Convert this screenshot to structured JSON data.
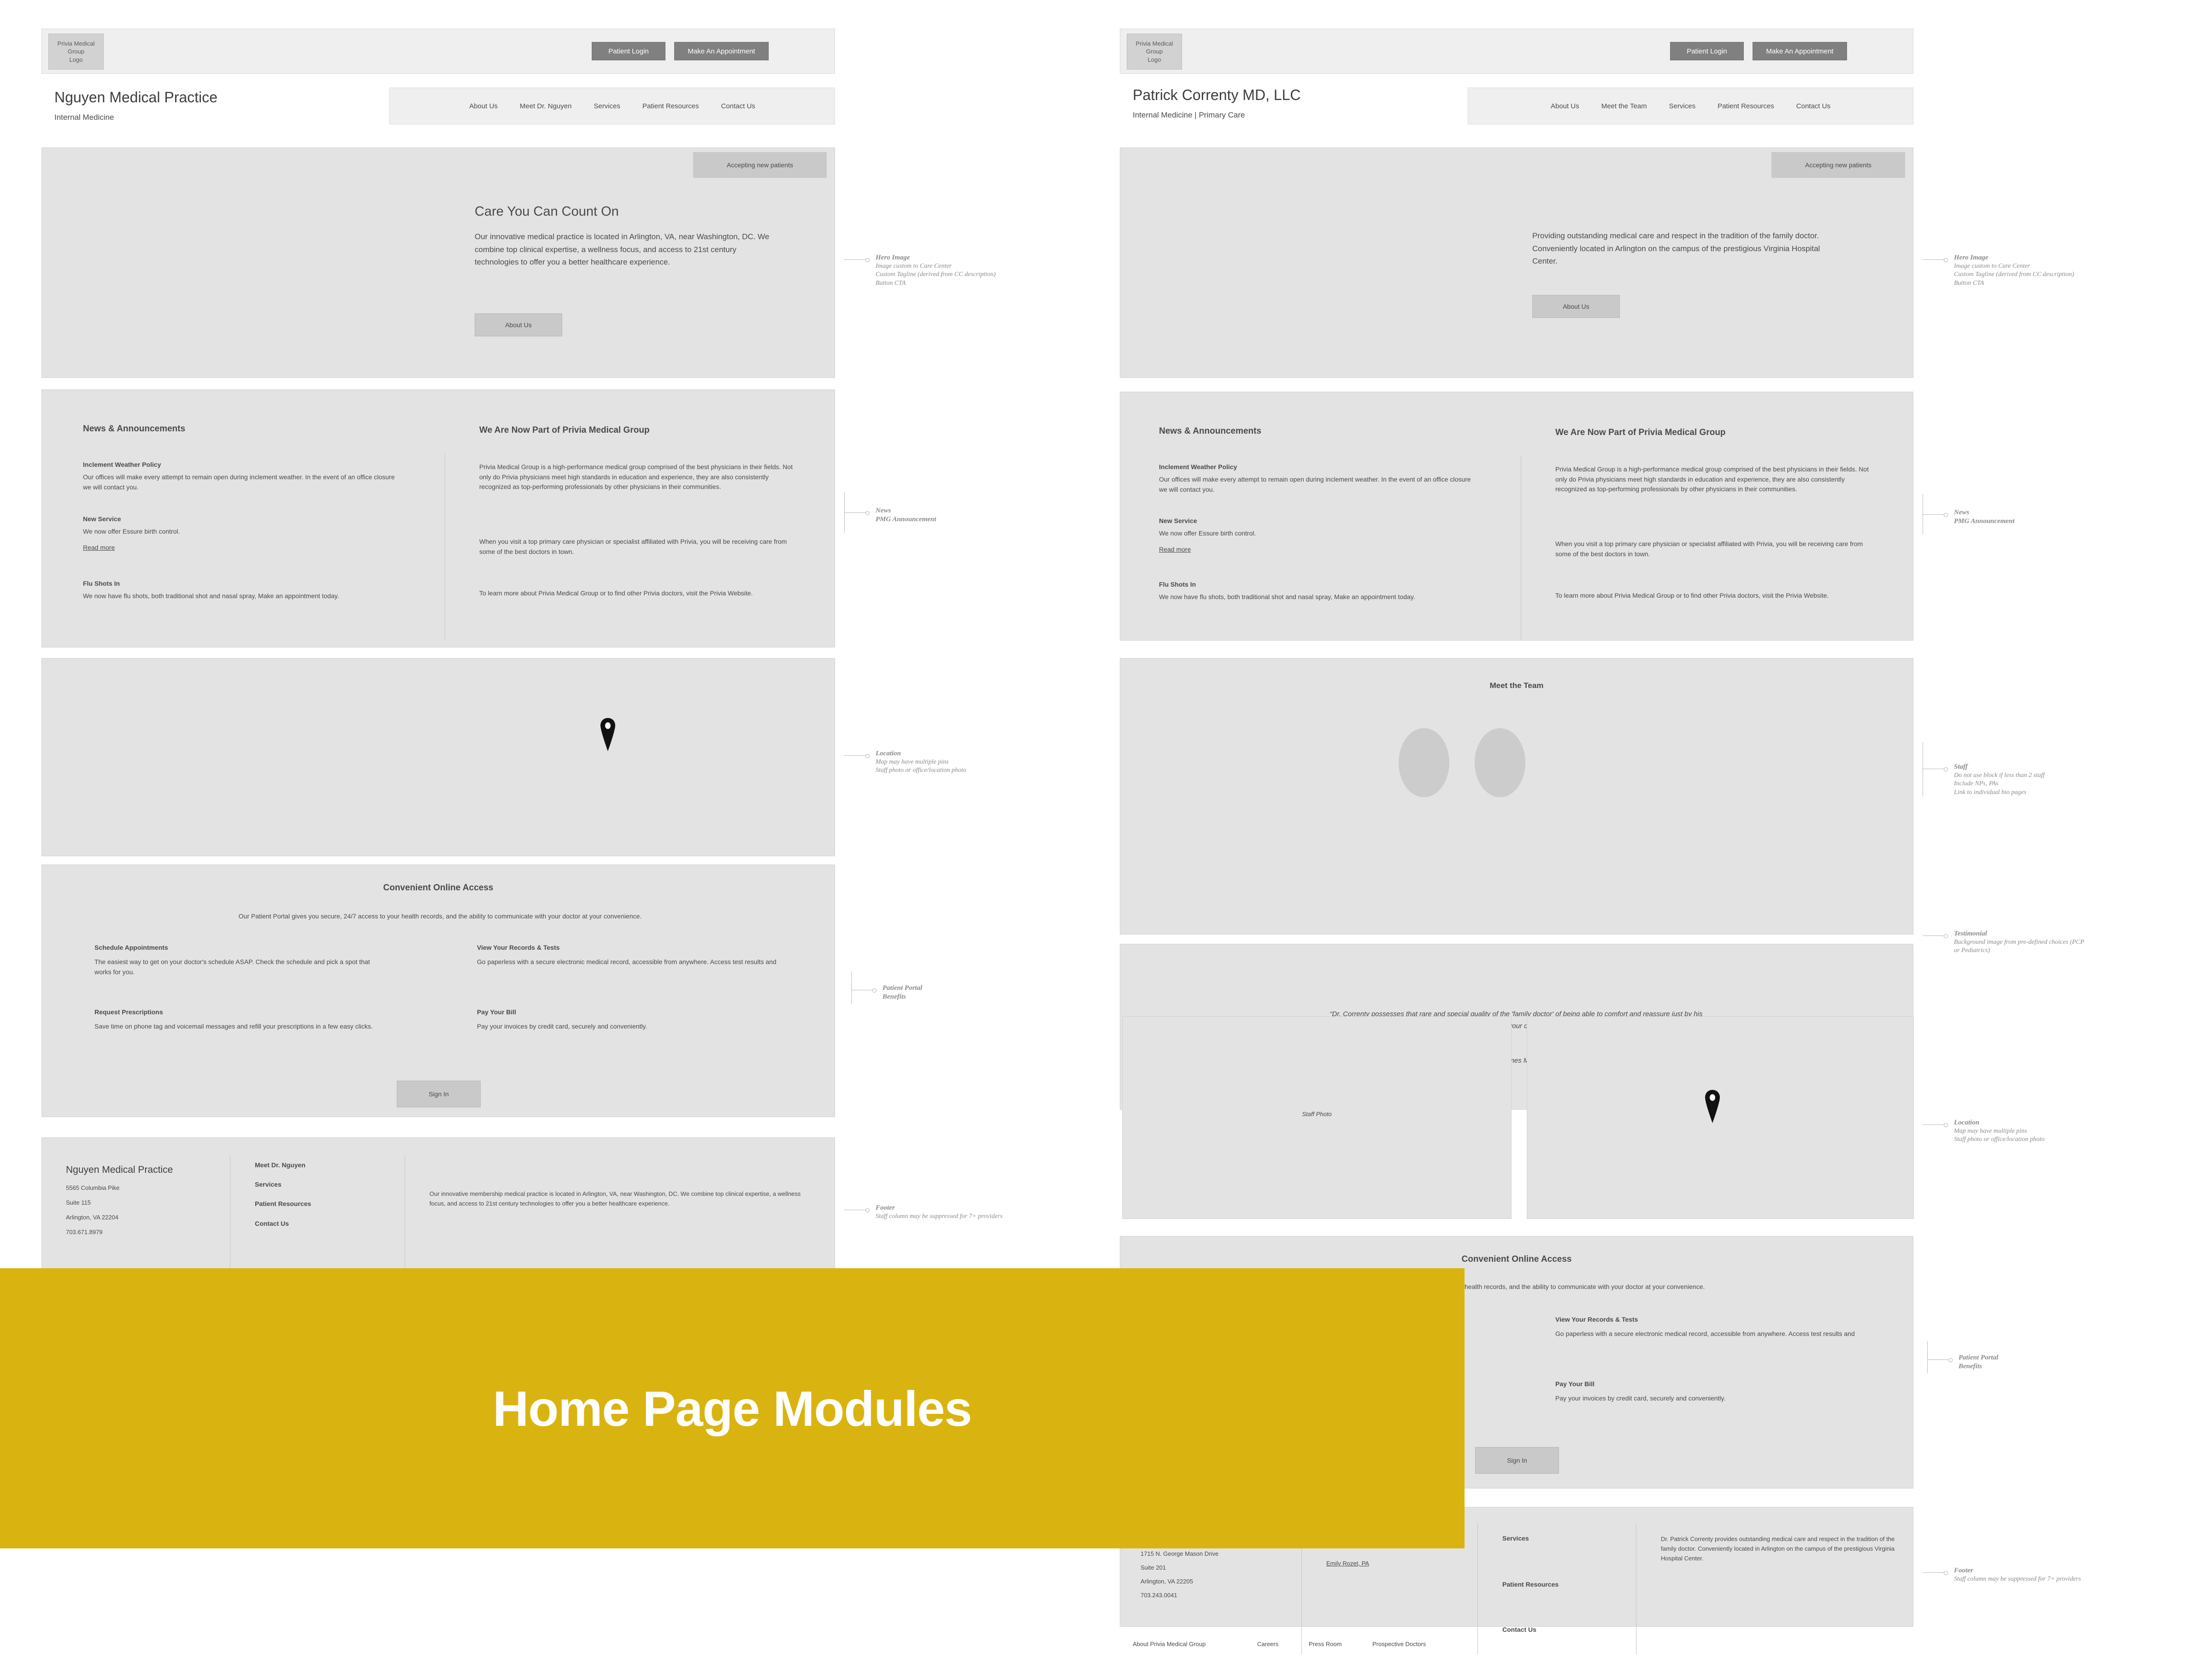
{
  "banner": {
    "title": "Home Page Modules",
    "color": "#d9b410"
  },
  "global": {
    "logo_text": "Privia Medical Group\nLogo",
    "patient_login": "Patient Login",
    "make_appointment": "Make An Appointment",
    "accepting": "Accepting new patients",
    "about_us_cta": "About Us",
    "sign_in": "Sign In",
    "read_more": "Read more",
    "privia_heading": "We Are Now Part of Privia Medical Group",
    "privia_p1": "Privia Medical Group is a high-performance medical group comprised of the best physicians in their fields. Not only do Privia physicians meet high standards in education and experience, they are also consistently recognized as top-performing professionals by other physicians in their communities.",
    "privia_p2": "When you visit a top primary care physician or specialist affiliated with Privia, you will be receiving care from some of the best doctors in town.",
    "privia_p3": "To learn more about Privia Medical Group or to find other Privia doctors, visit the Privia Website.",
    "news_heading": "News & Announcements",
    "news": [
      {
        "title": "Inclement Weather Policy",
        "body": "Our offices will make every attempt to remain open during inclement weather. In the event of an office closure we will contact you."
      },
      {
        "title": "New Service",
        "body": "We now offer Essure birth control."
      },
      {
        "title": "Flu Shots In",
        "body": "We now have flu shots, both traditional shot and nasal spray, Make an appointment today."
      }
    ],
    "portal": {
      "heading": "Convenient Online Access",
      "intro": "Our Patient Portal gives you secure, 24/7 access to your health records, and the ability to communicate with your doctor at your convenience.",
      "intro_clipped": "health records, and the ability to communicate with your doctor at your convenience.",
      "items": [
        {
          "title": "Schedule Appointments",
          "body": "The easiest way to get on your doctor's schedule ASAP. Check the schedule and pick a spot that works for you."
        },
        {
          "title": "View Your Records & Tests",
          "body": "Go paperless with a secure electronic medical record, accessible from anywhere. Access test results and"
        },
        {
          "title": "Request Prescriptions",
          "body": "Save time on phone tag and voicemail messages and refill your prescriptions in a few easy clicks."
        },
        {
          "title": "Pay Your Bill",
          "body": "Pay your invoices by credit card, securely and conveniently."
        }
      ]
    },
    "utility_links": [
      "About Privia Medical Group",
      "Careers",
      "Press Room",
      "Prospective Doctors"
    ]
  },
  "left": {
    "practice_name": "Nguyen Medical Practice",
    "specialty": "Internal Medicine",
    "nav": [
      "About Us",
      "Meet Dr. Nguyen",
      "Services",
      "Patient Resources",
      "Contact Us"
    ],
    "hero_title": "Care You Can Count On",
    "hero_body": "Our innovative medical practice is located in Arlington, VA, near Washington, DC. We combine top clinical expertise, a wellness focus, and access to 21st century technologies to offer you a better healthcare experience.",
    "footer": {
      "name": "Nguyen Medical Practice",
      "address": [
        "5565 Columbia Pike",
        "Suite 115",
        "Arlington, VA 22204",
        "703.671.8979"
      ],
      "links": [
        "Meet Dr. Nguyen",
        "Services",
        "Patient Resources",
        "Contact Us"
      ],
      "blurb": "Our innovative membership medical practice is located in Arlington, VA, near Washington, DC. We combine top clinical expertise, a wellness focus, and access to 21st century technologies to offer you a better healthcare experience."
    },
    "annotations": [
      {
        "title": "Hero Image",
        "lines": [
          "Image custom to Care Center",
          "Custom Tagline (derived from CC description)",
          "Button CTA"
        ]
      },
      {
        "title": "News",
        "lines": [
          "PMG Announcement"
        ]
      },
      {
        "title": "Location",
        "lines": [
          "Map may have multiple pins",
          "Staff photo or office/location photo"
        ]
      },
      {
        "title": "Patient Portal",
        "lines": [
          "Benefits"
        ]
      },
      {
        "title": "Footer",
        "lines": [
          "Staff column may be suppressed for 7+ providers"
        ]
      }
    ]
  },
  "right": {
    "practice_name": "Patrick Correnty MD, LLC",
    "specialty": "Internal Medicine | Primary Care",
    "nav": [
      "About Us",
      "Meet the Team",
      "Services",
      "Patient Resources",
      "Contact Us"
    ],
    "hero_body": "Providing outstanding medical care and respect in the tradition of the family doctor. Conveniently located in Arlington on the campus of the prestigious Virginia Hospital Center.",
    "team_heading": "Meet the Team",
    "testimonial_quote": "“Dr. Correnty possesses that rare and special quality of the 'family doctor' of being able to comfort and reassure just by his presence. Thank you for your competence and caring.”",
    "testimonial_author": "James M.",
    "staff_photo_label": "Staff Photo",
    "footer": {
      "address": [
        "1715 N. George Mason Drive",
        "Suite 201",
        "Arlington, VA 22205",
        "703.243.0041"
      ],
      "staff_link": "Emily Rozet, PA",
      "links": [
        "Services",
        "Patient Resources",
        "Contact Us"
      ],
      "blurb": "Dr. Patrick Correnty provides outstanding medical care and respect in the tradition of the family doctor. Conveniently located in Arlington on the campus of the prestigious Virginia Hospital Center."
    },
    "annotations": [
      {
        "title": "Hero Image",
        "lines": [
          "Image custom to Care Center",
          "Custom Tagline (derived from CC description)",
          "Button CTA"
        ]
      },
      {
        "title": "News",
        "lines": [
          "PMG Announcement"
        ]
      },
      {
        "title": "Staff",
        "lines": [
          "Do not use block if less than 2 staff",
          "Include NPs, PAs",
          "Link to individual bio pages"
        ]
      },
      {
        "title": "Testimonial",
        "lines": [
          "Background image from pre-defined choices (PCP",
          "or Pediatrics)"
        ]
      },
      {
        "title": "Location",
        "lines": [
          "Map may have multiple pins",
          "Staff photo or office/location photo"
        ]
      },
      {
        "title": "Patient Portal",
        "lines": [
          "Benefits"
        ]
      },
      {
        "title": "Footer",
        "lines": [
          "Staff column may be suppressed for 7+ providers"
        ]
      }
    ]
  }
}
